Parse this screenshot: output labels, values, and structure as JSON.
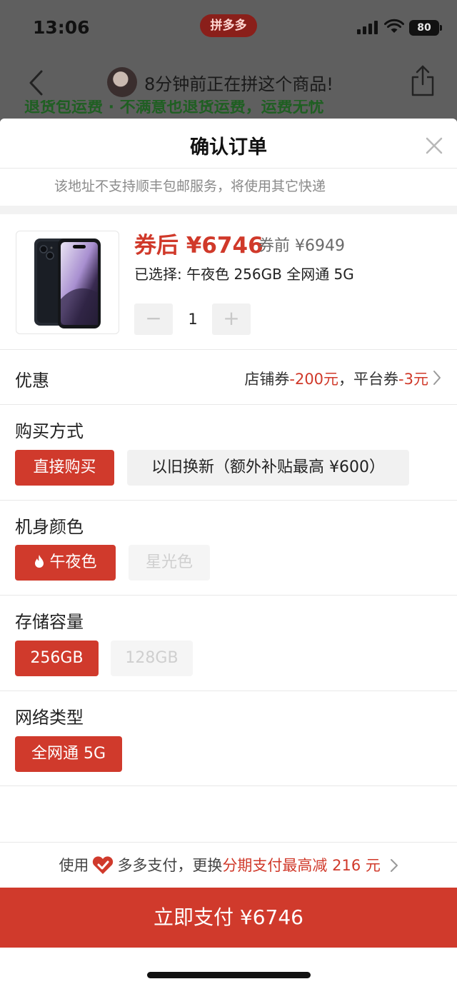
{
  "status_bar": {
    "time": "13:06",
    "app_badge": "拼多多",
    "battery": "80"
  },
  "top_nav": {
    "viewing_text": "8分钟前正在拼这个商品!",
    "strip_text": "退货包运费 · 不满意也退货运费，运费无忧"
  },
  "sheet": {
    "title": "确认订单",
    "address_note": "该地址不支持顺丰包邮服务，将使用其它快递"
  },
  "product": {
    "price_after_label": "券后 ¥6746",
    "price_before_label": "券前 ¥6949",
    "selected_text": "已选择: 午夜色 256GB 全网通 5G",
    "quantity": "1",
    "minus": "−",
    "plus": "+"
  },
  "promo": {
    "label": "优惠",
    "store_prefix": "店铺券",
    "store_value": "-200元",
    "separator": "，",
    "platform_prefix": "平台券",
    "platform_value": "-3元"
  },
  "purchase_method": {
    "label": "购买方式",
    "options": [
      "直接购买",
      "以旧换新（额外补贴最高 ¥600）"
    ]
  },
  "color": {
    "label": "机身颜色",
    "options": [
      "午夜色",
      "星光色"
    ]
  },
  "storage": {
    "label": "存储容量",
    "options": [
      "256GB",
      "128GB"
    ]
  },
  "network": {
    "label": "网络类型",
    "options": [
      "全网通 5G"
    ]
  },
  "payment_note": {
    "prefix": "使用",
    "middle": "多多支付，更换",
    "highlight": "分期支付最高减 216 元"
  },
  "pay_button": "立即支付 ¥6746",
  "colors": {
    "accent": "#d03a2c",
    "price": "#d0392a"
  }
}
